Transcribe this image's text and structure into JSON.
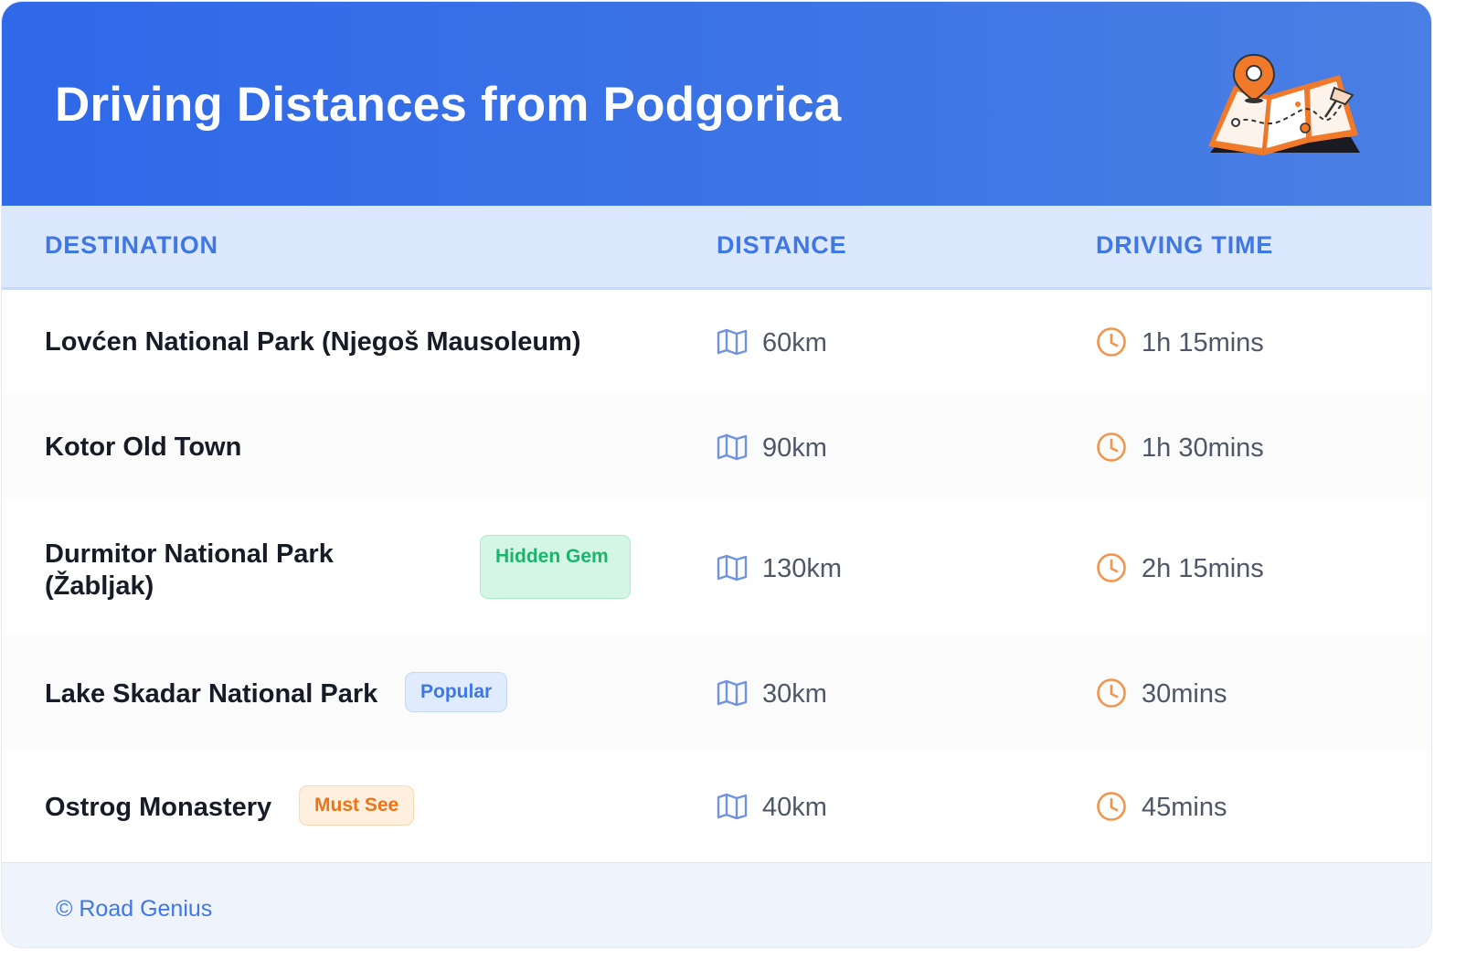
{
  "header": {
    "title": "Driving Distances from Podgorica",
    "illustration": "map-with-location-pin-icon",
    "accent_color": "#2f68e8"
  },
  "columns": {
    "destination": "DESTINATION",
    "distance": "DISTANCE",
    "driving_time": "DRIVING TIME"
  },
  "rows": [
    {
      "destination": "Lovćen National Park (Njegoš Mausoleum)",
      "badge": "",
      "distance": "60km",
      "time": "1h 15mins"
    },
    {
      "destination": "Kotor Old Town",
      "badge": "",
      "distance": "90km",
      "time": "1h 30mins"
    },
    {
      "destination": "Durmitor National Park (Žabljak)",
      "badge": "Hidden Gem",
      "distance": "130km",
      "time": "2h 15mins"
    },
    {
      "destination": "Lake Skadar National Park",
      "badge": "Popular",
      "distance": "30km",
      "time": "30mins"
    },
    {
      "destination": "Ostrog Monastery",
      "badge": "Must See",
      "distance": "40km",
      "time": "45mins"
    }
  ],
  "icons": {
    "distance": "map-icon",
    "time": "clock-icon"
  },
  "badge_colors": {
    "Hidden Gem": "#19b56b",
    "Popular": "#3e78e4",
    "Must See": "#ea7418"
  },
  "footer": {
    "text": "© Road Genius"
  }
}
